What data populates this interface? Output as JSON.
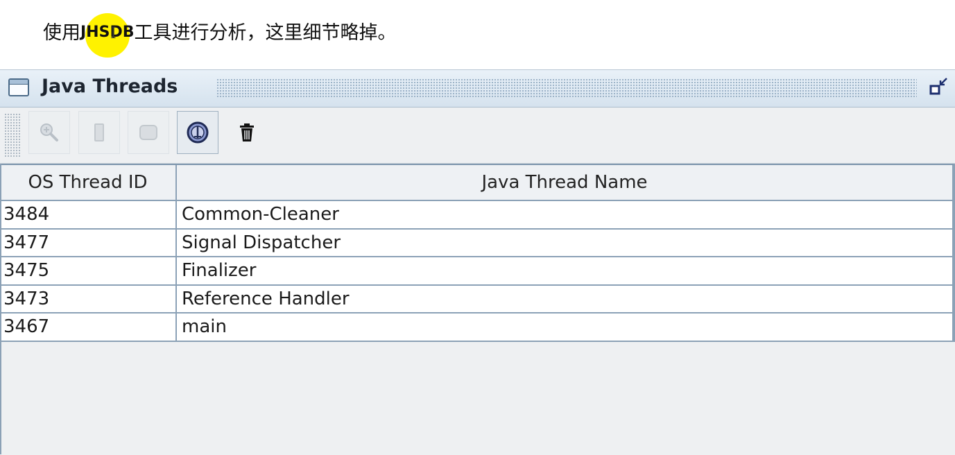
{
  "caption": {
    "before": "使用",
    "highlight": "JHSDB",
    "after": "工具进行分析，这里细节略掉。"
  },
  "window": {
    "title": "Java Threads",
    "icons": {
      "window": "window-icon",
      "restore": "restore-icon"
    }
  },
  "toolbar": {
    "buttons": [
      {
        "icon": "zoom-icon",
        "state": "disabled"
      },
      {
        "icon": "stack-icon",
        "state": "disabled"
      },
      {
        "icon": "object-icon",
        "state": "disabled"
      },
      {
        "icon": "inspect-icon",
        "state": "active"
      },
      {
        "icon": "trash-icon",
        "state": "enabled"
      }
    ]
  },
  "table": {
    "columns": [
      "OS Thread ID",
      "Java Thread Name"
    ],
    "rows": [
      {
        "id": "3484",
        "name": "Common-Cleaner"
      },
      {
        "id": "3477",
        "name": "Signal Dispatcher"
      },
      {
        "id": "3475",
        "name": "Finalizer"
      },
      {
        "id": "3473",
        "name": "Reference Handler"
      },
      {
        "id": "3467",
        "name": "main"
      }
    ]
  },
  "colors": {
    "highlight": "#fff200",
    "grid": "#8ba1b6",
    "titlebar": "#d5e2ee"
  }
}
